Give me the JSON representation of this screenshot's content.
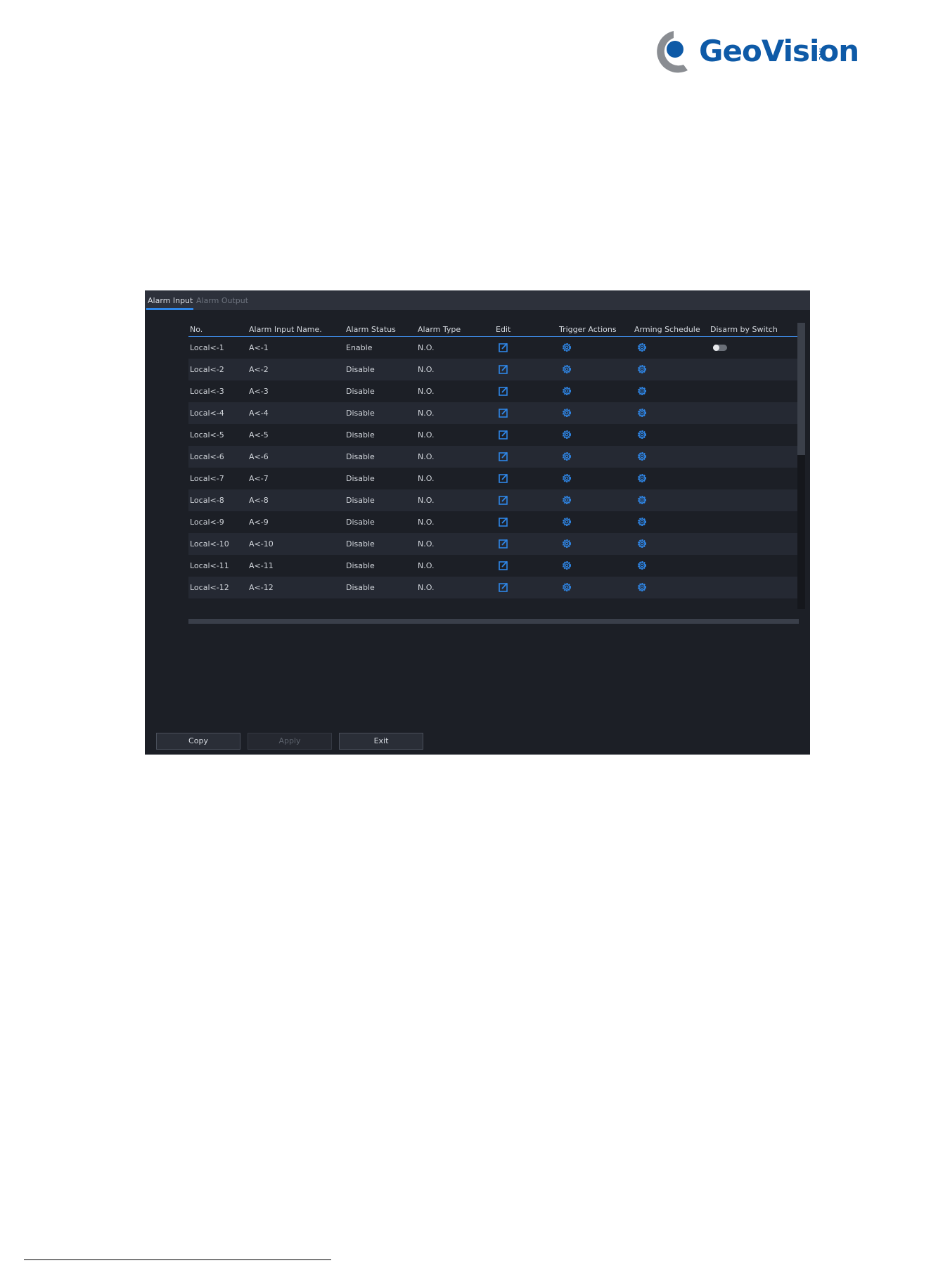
{
  "logo": {
    "brand": "GeoVision",
    "suffix": "inc",
    "color": "#0e5aa7"
  },
  "tabs": [
    {
      "label": "Alarm Input",
      "active": true
    },
    {
      "label": "Alarm Output",
      "active": false
    }
  ],
  "table": {
    "columns": [
      "No.",
      "Alarm Input Name.",
      "Alarm Status",
      "Alarm Type",
      "Edit",
      "Trigger Actions",
      "Arming Schedule",
      "Disarm by Switch"
    ],
    "rows": [
      {
        "no": "Local<-1",
        "name": "A<-1",
        "status": "Enable",
        "type": "N.O.",
        "disarm_switch": "off"
      },
      {
        "no": "Local<-2",
        "name": "A<-2",
        "status": "Disable",
        "type": "N.O."
      },
      {
        "no": "Local<-3",
        "name": "A<-3",
        "status": "Disable",
        "type": "N.O."
      },
      {
        "no": "Local<-4",
        "name": "A<-4",
        "status": "Disable",
        "type": "N.O."
      },
      {
        "no": "Local<-5",
        "name": "A<-5",
        "status": "Disable",
        "type": "N.O."
      },
      {
        "no": "Local<-6",
        "name": "A<-6",
        "status": "Disable",
        "type": "N.O."
      },
      {
        "no": "Local<-7",
        "name": "A<-7",
        "status": "Disable",
        "type": "N.O."
      },
      {
        "no": "Local<-8",
        "name": "A<-8",
        "status": "Disable",
        "type": "N.O."
      },
      {
        "no": "Local<-9",
        "name": "A<-9",
        "status": "Disable",
        "type": "N.O."
      },
      {
        "no": "Local<-10",
        "name": "A<-10",
        "status": "Disable",
        "type": "N.O."
      },
      {
        "no": "Local<-11",
        "name": "A<-11",
        "status": "Disable",
        "type": "N.O."
      },
      {
        "no": "Local<-12",
        "name": "A<-12",
        "status": "Disable",
        "type": "N.O."
      }
    ]
  },
  "icons": {
    "edit": "edit-icon",
    "trigger": "gear-icon",
    "schedule": "gear-icon",
    "accent": "#2f87e8"
  },
  "buttons": {
    "copy": "Copy",
    "apply": "Apply",
    "exit": "Exit"
  }
}
